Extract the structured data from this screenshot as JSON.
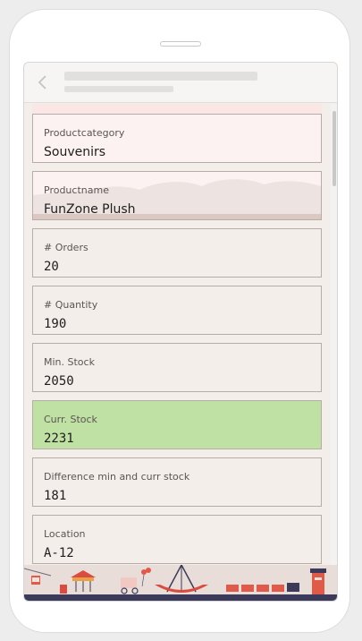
{
  "fields": [
    {
      "label": "Productcategory",
      "value": "Souvenirs",
      "style": "pinkish",
      "font": "sans"
    },
    {
      "label": "Productname",
      "value": "FunZone Plush",
      "style": "pinkish-clouds",
      "font": "sans"
    },
    {
      "label": "# Orders",
      "value": "20",
      "style": "normal",
      "font": "mono"
    },
    {
      "label": "# Quantity",
      "value": "190",
      "style": "normal",
      "font": "mono"
    },
    {
      "label": "Min. Stock",
      "value": "2050",
      "style": "normal",
      "font": "mono"
    },
    {
      "label": "Curr. Stock",
      "value": "2231",
      "style": "green",
      "font": "mono"
    },
    {
      "label": "Difference min and curr stock",
      "value": "181",
      "style": "normal",
      "font": "mono"
    },
    {
      "label": "Location",
      "value": "A-12",
      "style": "normal",
      "font": "mono"
    }
  ],
  "colors": {
    "highlight": "#bfe1a3",
    "card_border": "#b7aca6",
    "band": "#dbc8c2",
    "background": "#f4eeeb"
  },
  "icons": {
    "back": "chevron-left-icon"
  }
}
